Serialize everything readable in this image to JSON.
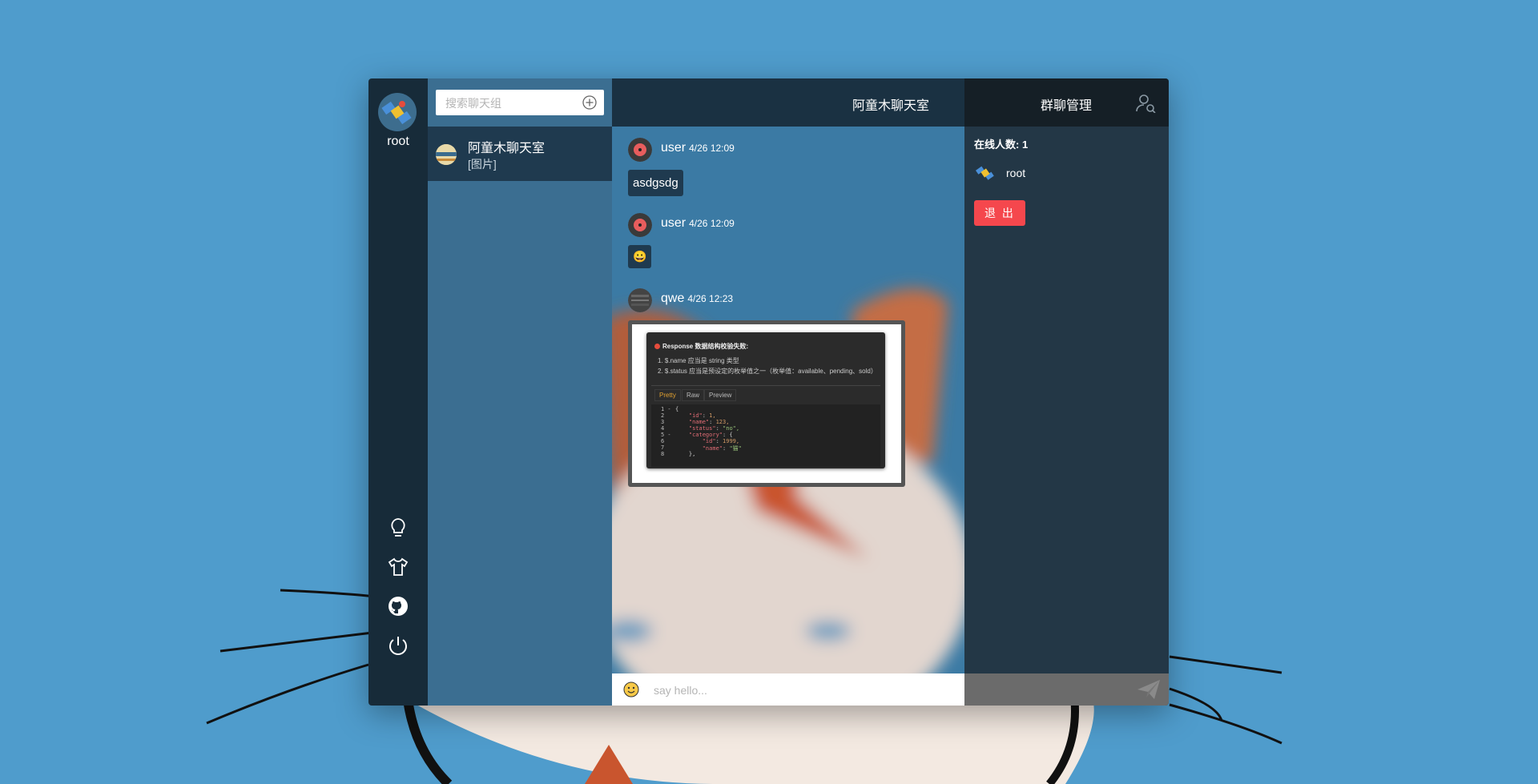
{
  "user": {
    "name": "root"
  },
  "rail": {
    "icons": [
      "lightbulb-icon",
      "tshirt-icon",
      "github-icon",
      "power-icon"
    ]
  },
  "search": {
    "placeholder": "搜索聊天组"
  },
  "rooms": [
    {
      "name": "阿童木聊天室",
      "last_message": "[图片]"
    }
  ],
  "chat": {
    "title": "阿童木聊天室",
    "messages": [
      {
        "user": "user",
        "time": "4/26 12:09",
        "type": "text",
        "content": "asdgsdg"
      },
      {
        "user": "user",
        "time": "4/26 12:09",
        "type": "emoji",
        "content": "😀"
      },
      {
        "user": "qwe",
        "time": "4/26 12:23",
        "type": "image"
      }
    ],
    "image": {
      "heading": "Response 数据结构校验失败:",
      "line1": "1. $.name 应当是 string 类型",
      "line2": "2. $.status 应当是预设定的枚举值之一（枚举值：available、pending、sold）",
      "tabs": [
        "Pretty",
        "Raw",
        "Preview"
      ]
    },
    "composer_placeholder": "say hello..."
  },
  "panel": {
    "title": "群聊管理",
    "online_label": "在线人数: 1",
    "members": [
      {
        "name": "root"
      }
    ],
    "quit_label": "退 出"
  },
  "colors": {
    "background": "#4f9ccc",
    "rail": "#172b39",
    "list": "#3b6e91",
    "active_room": "#1f3a4f",
    "quit": "#f5474d"
  }
}
